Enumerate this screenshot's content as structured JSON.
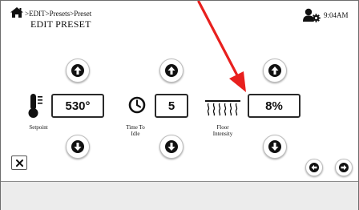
{
  "header": {
    "breadcrumb": ">EDIT>Presets>Preset",
    "title": "EDIT PRESET",
    "time": "9:04AM"
  },
  "controls": [
    {
      "name": "setpoint",
      "value": "530°",
      "label": "Setpoint",
      "icon": "thermometer-icon"
    },
    {
      "name": "time-to-idle",
      "value": "5",
      "label": "Time To Idle",
      "label_lines": [
        "Time To",
        "Idle"
      ],
      "icon": "clock-icon"
    },
    {
      "name": "floor-intensity",
      "value": "8%",
      "label": "Floor Intensity",
      "label_lines": [
        "Floor",
        "Intensity"
      ],
      "icon": "floor-heat-icon"
    }
  ],
  "icons": {
    "home": "home-icon",
    "user_settings": "user-settings-icon",
    "increase": "arrow-up-icon",
    "decrease": "arrow-down-icon",
    "close": "close-icon",
    "previous": "arrow-left-icon",
    "next": "arrow-right-icon"
  },
  "colors": {
    "annotation_arrow": "#e8201e",
    "footer_background": "#ececec",
    "value_border": "#2a2a2a"
  }
}
